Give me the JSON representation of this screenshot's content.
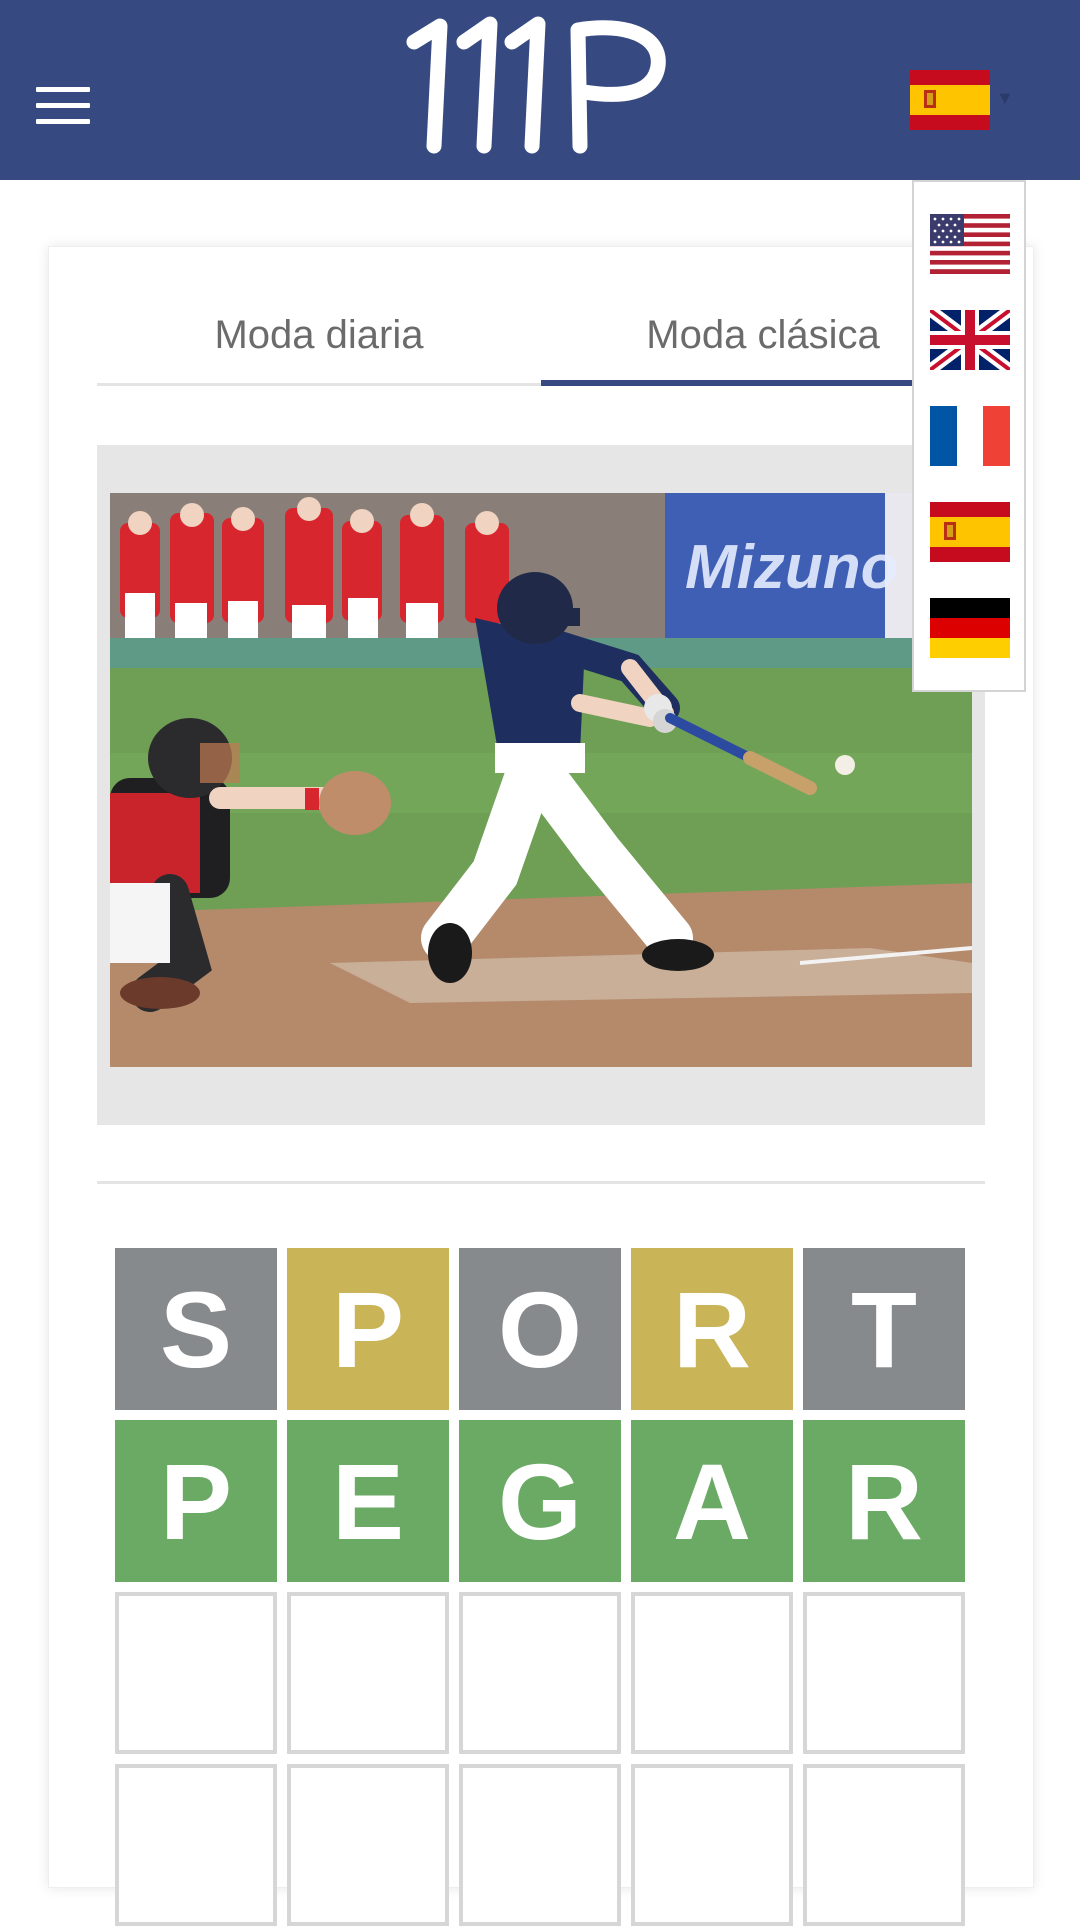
{
  "header": {
    "menu_icon": "hamburger-menu-icon",
    "logo_text": "111P",
    "current_language_flag": "spain-flag-icon",
    "dropdown_icon": "caret-down-icon",
    "background_color": "#364a81"
  },
  "language_menu": {
    "options": [
      {
        "flag": "usa-flag-icon"
      },
      {
        "flag": "uk-flag-icon"
      },
      {
        "flag": "france-flag-icon"
      },
      {
        "flag": "spain-flag-icon"
      },
      {
        "flag": "germany-flag-icon"
      }
    ]
  },
  "tabs": [
    {
      "label": "Moda diaria",
      "active": false
    },
    {
      "label": "Moda clásica",
      "active": true
    }
  ],
  "image": {
    "subject": "baseball-batter-photo"
  },
  "grid": {
    "rows": [
      {
        "tiles": [
          {
            "letter": "S",
            "state": "gray"
          },
          {
            "letter": "P",
            "state": "yellow"
          },
          {
            "letter": "O",
            "state": "gray"
          },
          {
            "letter": "R",
            "state": "yellow"
          },
          {
            "letter": "T",
            "state": "gray"
          }
        ]
      },
      {
        "tiles": [
          {
            "letter": "P",
            "state": "green"
          },
          {
            "letter": "E",
            "state": "green"
          },
          {
            "letter": "G",
            "state": "green"
          },
          {
            "letter": "A",
            "state": "green"
          },
          {
            "letter": "R",
            "state": "green"
          }
        ]
      },
      {
        "tiles": [
          {
            "letter": "",
            "state": "empty"
          },
          {
            "letter": "",
            "state": "empty"
          },
          {
            "letter": "",
            "state": "empty"
          },
          {
            "letter": "",
            "state": "empty"
          },
          {
            "letter": "",
            "state": "empty"
          }
        ]
      },
      {
        "tiles": [
          {
            "letter": "",
            "state": "empty"
          },
          {
            "letter": "",
            "state": "empty"
          },
          {
            "letter": "",
            "state": "empty"
          },
          {
            "letter": "",
            "state": "empty"
          },
          {
            "letter": "",
            "state": "empty"
          }
        ]
      }
    ]
  },
  "colors": {
    "gray": "#878a8c",
    "yellow": "#c9b458",
    "green": "#6aaa64",
    "accent": "#364a81"
  }
}
